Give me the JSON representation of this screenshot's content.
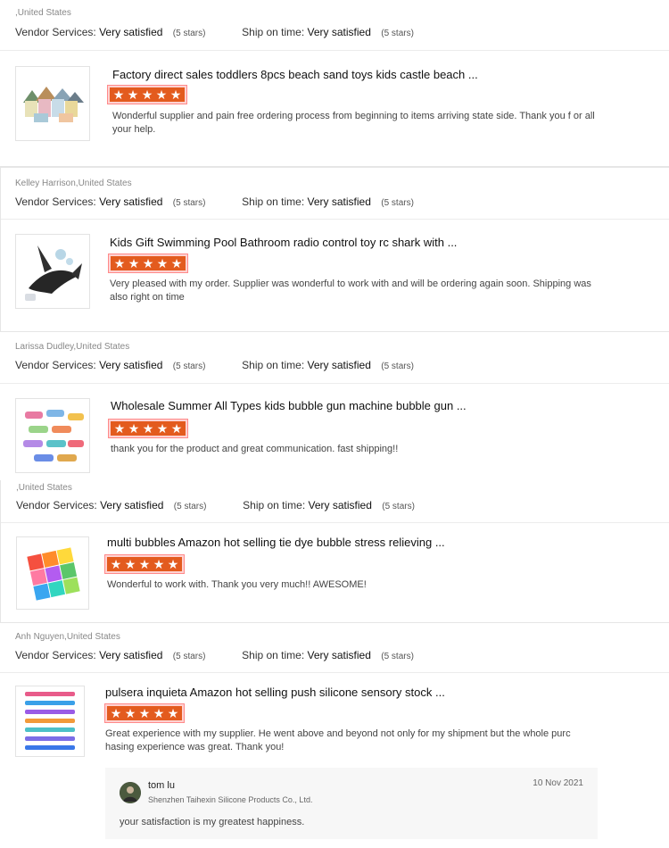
{
  "reviews": [
    {
      "reviewer": ",United States",
      "vendor_label": "Vendor Services:",
      "vendor_value": "Very satisfied",
      "vendor_stars": "(5 stars)",
      "ship_label": "Ship on time:",
      "ship_value": "Very satisfied",
      "ship_stars": "(5 stars)",
      "product_title": "Factory direct sales toddlers 8pcs beach sand toys kids castle beach ...",
      "rating": 5,
      "comment": "Wonderful supplier and pain free ordering process from beginning to items arriving state side.  Thank you f or all your help."
    },
    {
      "reviewer": "Kelley Harrison,United States",
      "vendor_label": "Vendor Services:",
      "vendor_value": "Very satisfied",
      "vendor_stars": "(5 stars)",
      "ship_label": "Ship on time:",
      "ship_value": "Very satisfied",
      "ship_stars": "(5 stars)",
      "product_title": "Kids Gift Swimming Pool Bathroom radio control toy rc shark with ...",
      "rating": 5,
      "comment": "Very pleased with my order. Supplier was wonderful to work with and will be ordering again soon. Shipping was also right on time"
    },
    {
      "reviewer": "Larissa Dudley,United States",
      "vendor_label": "Vendor Services:",
      "vendor_value": "Very satisfied",
      "vendor_stars": "(5 stars)",
      "ship_label": "Ship on time:",
      "ship_value": "Very satisfied",
      "ship_stars": "(5 stars)",
      "product_title": "Wholesale Summer All Types kids bubble gun machine bubble gun ...",
      "rating": 5,
      "comment": "thank you for the product and great communication. fast shipping!!"
    },
    {
      "reviewer": ",United States",
      "vendor_label": "Vendor Services:",
      "vendor_value": "Very satisfied",
      "vendor_stars": "(5 stars)",
      "ship_label": "Ship on time:",
      "ship_value": "Very satisfied",
      "ship_stars": "(5 stars)",
      "product_title": "multi bubbles Amazon hot selling tie dye bubble stress relieving ...",
      "rating": 5,
      "comment": "Wonderful to work with. Thank you very much!! AWESOME!"
    },
    {
      "reviewer": "Anh Nguyen,United States",
      "vendor_label": "Vendor Services:",
      "vendor_value": "Very satisfied",
      "vendor_stars": "(5 stars)",
      "ship_label": "Ship on time:",
      "ship_value": "Very satisfied",
      "ship_stars": "(5 stars)",
      "product_title": "pulsera inquieta Amazon hot selling push silicone sensory stock ...",
      "rating": 5,
      "comment": "Great experience with my supplier. He went above and beyond not only for my shipment but the whole purc hasing experience was great. Thank you!"
    }
  ],
  "reply": {
    "name": "tom lu",
    "company": "Shenzhen Taihexin Silicone Products Co., Ltd.",
    "date": "10 Nov 2021",
    "text": "your satisfaction is my greatest happiness."
  },
  "star_glyph": "★",
  "colors": {
    "star_bg": "#e35b1e",
    "star_outline": "#ff8a8a"
  }
}
